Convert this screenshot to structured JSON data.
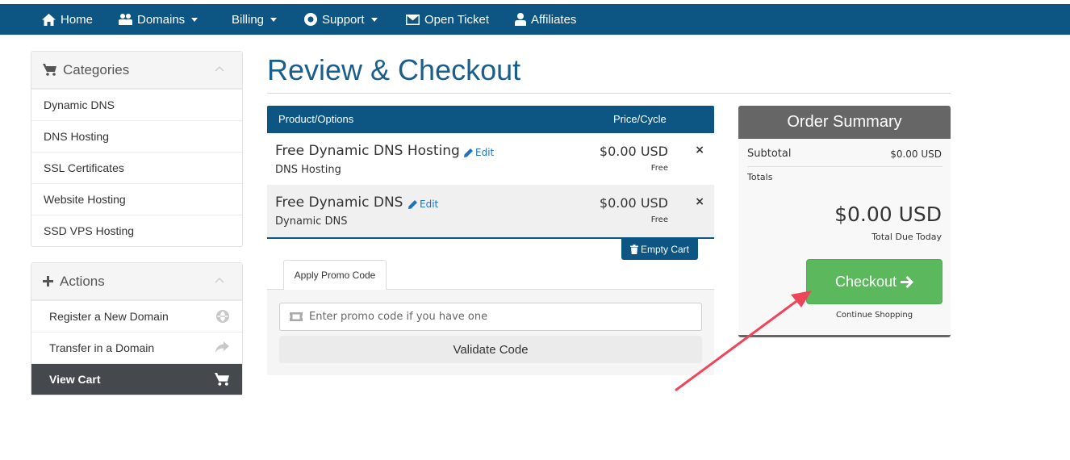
{
  "nav": {
    "items": [
      {
        "label": "Home",
        "icon": "home-icon"
      },
      {
        "label": "Domains",
        "icon": "users-icon",
        "dropdown": true
      },
      {
        "label": "Billing",
        "dropdown": true
      },
      {
        "label": "Support",
        "icon": "lifesaver-icon",
        "dropdown": true
      },
      {
        "label": "Open Ticket",
        "icon": "envelope-icon"
      },
      {
        "label": "Affiliates",
        "icon": "user-icon"
      }
    ]
  },
  "sidebar": {
    "categories": {
      "title": "Categories",
      "items": [
        {
          "label": "Dynamic DNS"
        },
        {
          "label": "DNS Hosting"
        },
        {
          "label": "SSL Certificates"
        },
        {
          "label": "Website Hosting"
        },
        {
          "label": "SSD VPS Hosting"
        }
      ]
    },
    "actions": {
      "title": "Actions",
      "items": [
        {
          "label": "Register a New Domain",
          "icon": "globe-icon"
        },
        {
          "label": "Transfer in a Domain",
          "icon": "share-arrow-icon"
        },
        {
          "label": "View Cart",
          "icon": "cart-icon",
          "active": true
        }
      ]
    }
  },
  "main": {
    "title": "Review & Checkout",
    "cart": {
      "col_product": "Product/Options",
      "col_price": "Price/Cycle",
      "items": [
        {
          "name": "Free Dynamic DNS Hosting",
          "edit": "Edit",
          "group": "DNS Hosting",
          "price": "$0.00 USD",
          "cycle": "Free",
          "remove": "×"
        },
        {
          "name": "Free Dynamic DNS",
          "edit": "Edit",
          "group": "Dynamic DNS",
          "price": "$0.00 USD",
          "cycle": "Free",
          "remove": "×"
        }
      ],
      "empty_cart": "Empty Cart"
    },
    "promo": {
      "tab_label": "Apply Promo Code",
      "placeholder": "Enter promo code if you have one",
      "validate_label": "Validate Code"
    }
  },
  "summary": {
    "title": "Order Summary",
    "subtotal_label": "Subtotal",
    "subtotal_value": "$0.00 USD",
    "totals_label": "Totals",
    "total_amount": "$0.00 USD",
    "total_due_label": "Total Due Today",
    "checkout_label": "Checkout",
    "continue_label": "Continue Shopping"
  },
  "colors": {
    "brand": "#0d5583",
    "checkout": "#5cb85c",
    "annotation_arrow": "#f0445a"
  }
}
